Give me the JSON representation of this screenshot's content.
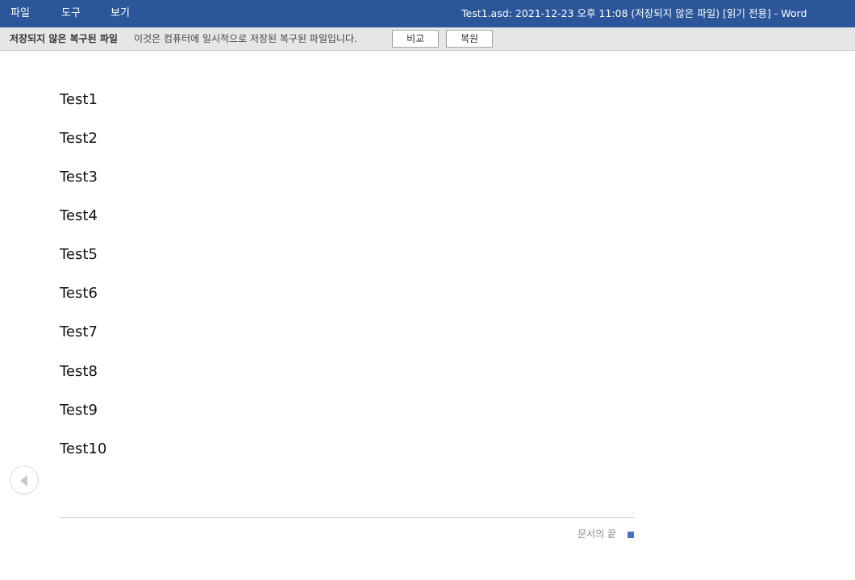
{
  "menu": {
    "items": [
      "파일",
      "도구",
      "보기"
    ]
  },
  "window": {
    "title": "Test1.asd: 2021-12-23 오후 11:08 (저장되지 않은 파일) [읽기 전용] - Word"
  },
  "infobar": {
    "label": "저장되지 않은 복구된 파일",
    "message": "이것은 컴퓨터에 일시적으로 저장된 복구된 파일입니다.",
    "compare_button": "비교",
    "restore_button": "복원"
  },
  "document": {
    "lines": [
      "Test1",
      "Test2",
      "Test3",
      "Test4",
      "Test5",
      "Test6",
      "Test7",
      "Test8",
      "Test9",
      "Test10"
    ],
    "end_label": "문서의 끝"
  },
  "icons": {
    "nav": "chevron-left-circle-icon",
    "end_marker": "end-of-document-marker"
  },
  "colors": {
    "titlebar": "#2b579a",
    "infobar": "#e6e6e6",
    "end_marker": "#4472c4"
  }
}
